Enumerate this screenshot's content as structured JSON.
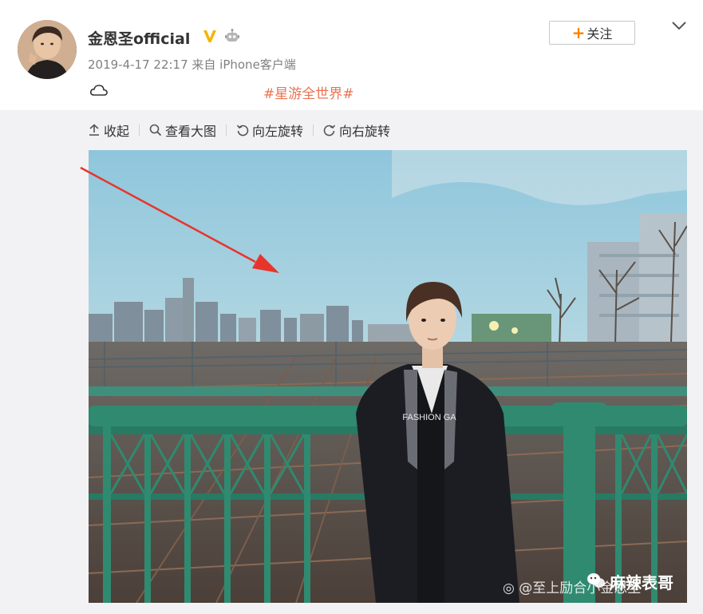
{
  "post": {
    "username": "金恩圣official",
    "meta": "2019-4-17 22:17 来自 iPhone客户端",
    "hashtag": "#星游全世界#",
    "follow_label": "关注"
  },
  "toolbar": {
    "collapse": "收起",
    "view_large": "查看大图",
    "rotate_left": "向左旋转",
    "rotate_right": "向右旋转"
  },
  "photo": {
    "shirt_text": "FASHION GA",
    "watermark_weibo": "@至上励合小金恩圣",
    "watermark_label": "麻辣表哥"
  },
  "colors": {
    "hashtag": "#eb7350",
    "follow_plus": "#ff8200",
    "verified": "#f5b400",
    "arrow": "#e8352b"
  },
  "icons": [
    "verified-icon",
    "robot-icon",
    "cloud-icon",
    "upload-icon",
    "search-icon",
    "rotate-left-icon",
    "rotate-right-icon",
    "chevron-down-icon",
    "weibo-icon",
    "wechat-icon"
  ]
}
